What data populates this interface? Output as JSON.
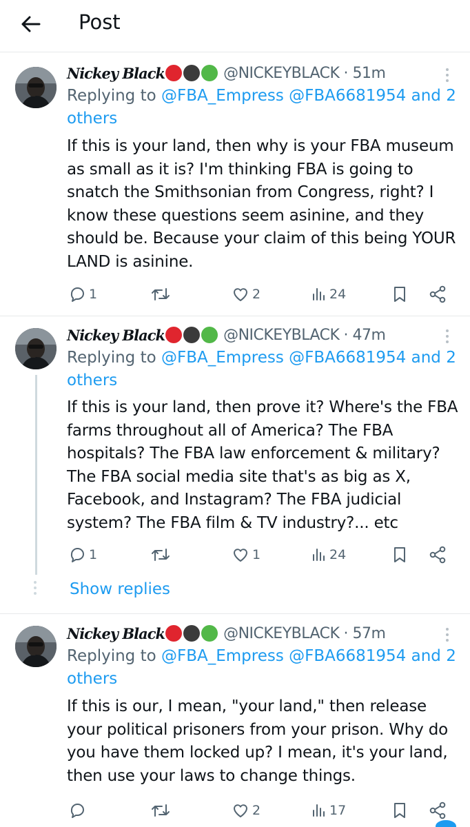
{
  "header": {
    "title": "Post"
  },
  "status_colors": {
    "red": "#e0252e",
    "black": "#3b3b3b",
    "green": "#52b848"
  },
  "posts": [
    {
      "name": "Nickey Black",
      "handle": "@NICKEYBLACK",
      "time": "51m",
      "replying_prefix": "Replying to ",
      "replying_mentions": "@FBA_Empress @FBA6681954 and 2",
      "replying_line2": "others",
      "body": "If this is your land, then why is your FBA museum as small as it is? I'm thinking FBA is going to snatch the Smithsonian from Congress, right? I know these questions seem asinine, and they should be. Because your claim of this being YOUR LAND is asinine.",
      "replies": "1",
      "reposts": "",
      "likes": "2",
      "views": "24"
    },
    {
      "name": "Nickey Black",
      "handle": "@NICKEYBLACK",
      "time": "47m",
      "replying_prefix": "Replying to ",
      "replying_mentions": "@FBA_Empress @FBA6681954 and 2",
      "replying_line2": "others",
      "body": "If this is your land, then prove it? Where's the FBA farms throughout all of America? The FBA hospitals? The FBA law enforcement & military? The FBA social media site that's as big as X, Facebook, and Instagram? The FBA judicial system? The FBA film & TV industry?... etc",
      "replies": "1",
      "reposts": "",
      "likes": "1",
      "views": "24",
      "show_replies": "Show replies"
    },
    {
      "name": "Nickey Black",
      "handle": "@NICKEYBLACK",
      "time": "57m",
      "replying_prefix": "Replying to ",
      "replying_mentions": "@FBA_Empress @FBA6681954 and 2",
      "replying_line2": "others",
      "body": "If this is our, I mean,  \"your land,\" then release your political prisoners from your prison. Why do you have them locked up? I mean, it's your land, then use your laws to change things.",
      "likes": "2",
      "views": "17"
    }
  ]
}
